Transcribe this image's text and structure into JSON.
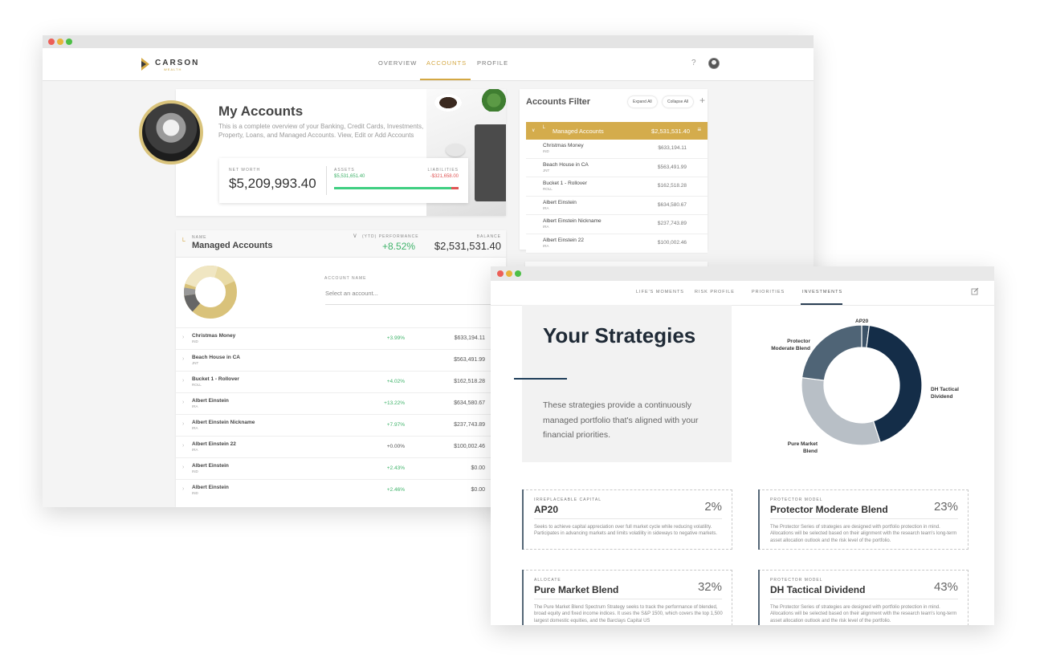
{
  "accounts_window": {
    "logo": "CARSON",
    "logo_sub": "WEALTH",
    "nav": [
      "OVERVIEW",
      "ACCOUNTS",
      "PROFILE"
    ],
    "help": "?",
    "my_accounts": {
      "title": "My Accounts",
      "description": "This is a complete overview of your Banking, Credit Cards, Investments, Property, Loans, and Managed Accounts. View, Edit or Add Accounts",
      "net_worth_label": "NET WORTH",
      "net_worth": "$5,209,993.40",
      "assets_label": "ASSETS",
      "assets": "$5,531,651.40",
      "liabilities_label": "LIABILITIES",
      "liabilities": "-$321,658.00",
      "asset_share": 0.945
    },
    "managed": {
      "name_label": "NAME",
      "title": "Managed Accounts",
      "performance_label": "(YTD) PERFORMANCE",
      "performance": "+8.52%",
      "balance_label": "BALANCE",
      "balance": "$2,531,531.40",
      "account_name_label": "ACCOUNT NAME",
      "account_placeholder": "Select an account...",
      "rows": [
        {
          "name": "Christmas Money",
          "type": "IND",
          "perf": "+3.99%",
          "balance": "$633,194.11"
        },
        {
          "name": "Beach House in CA",
          "type": "JNT",
          "perf": "",
          "balance": "$563,491.99"
        },
        {
          "name": "Bucket 1 - Rollover",
          "type": "ROLL",
          "perf": "+4.02%",
          "balance": "$162,518.28"
        },
        {
          "name": "Albert Einstein",
          "type": "IRA",
          "perf": "+13.22%",
          "balance": "$634,580.67"
        },
        {
          "name": "Albert Einstein Nickname",
          "type": "IRA",
          "perf": "+7.97%",
          "balance": "$237,743.89"
        },
        {
          "name": "Albert Einstein 22",
          "type": "IRA",
          "perf": "+0.00%",
          "balance": "$100,002.46"
        },
        {
          "name": "Albert Einstein",
          "type": "IND",
          "perf": "+2.43%",
          "balance": "$0.00"
        },
        {
          "name": "Albert Einstein",
          "type": "IND",
          "perf": "+2.46%",
          "balance": "$0.00"
        }
      ]
    },
    "filter": {
      "title": "Accounts Filter",
      "expand": "Expand All",
      "collapse": "Collapse All",
      "plus": "+",
      "group": "Managed Accounts",
      "group_value": "$2,531,531.40",
      "rows": [
        {
          "name": "Christmas Money",
          "type": "IND",
          "balance": "$633,194.11"
        },
        {
          "name": "Beach House in CA",
          "type": "JNT",
          "balance": "$563,491.99"
        },
        {
          "name": "Bucket 1 - Rollover",
          "type": "ROLL",
          "balance": "$162,518.28"
        },
        {
          "name": "Albert Einstein",
          "type": "IRA",
          "balance": "$634,580.67"
        },
        {
          "name": "Albert Einstein Nickname",
          "type": "IRA",
          "balance": "$237,743.89"
        },
        {
          "name": "Albert Einstein 22",
          "type": "IRA",
          "balance": "$100,002.46"
        }
      ]
    },
    "colors": {
      "gold": "#d4a843",
      "green": "#3fb36a",
      "red": "#e05555"
    }
  },
  "strategies_window": {
    "tabs": [
      "LIFE'S MOMENTS",
      "RISK PROFILE",
      "PRIORITIES",
      "INVESTMENTS"
    ],
    "title": "Your Strategies",
    "description": "These strategies provide a continuously managed portfolio that's aligned with your financial priorities.",
    "donut_labels": {
      "ap20": "AP20",
      "protector": "Protector Moderate Blend",
      "dh": "DH Tactical Dividend",
      "pure": "Pure Market Blend"
    },
    "cards": [
      {
        "category": "IRREPLACEABLE CAPITAL",
        "name": "AP20",
        "percent": "2%",
        "desc": "Seeks to achieve capital appreciation over full market cycle while reducing volatility. Participates in advancing markets and limits volatility in sideways to negative markets."
      },
      {
        "category": "PROTECTOR MODEL",
        "name": "Protector Moderate Blend",
        "percent": "23%",
        "desc": "The Protector Series of strategies are designed with portfolio protection in mind. Allocations will be selected based on their alignment with the research team's long-term asset allocation outlook and the risk level of the portfolio."
      },
      {
        "category": "ALLOCATE",
        "name": "Pure Market Blend",
        "percent": "32%",
        "desc": "The Pure Market Blend Spectrum Strategy seeks to track the performance of blended, broad equity and fixed income indices. It uses the S&P 1500, which covers the top 1,500 largest domestic equities, and the Barclays Capital US"
      },
      {
        "category": "PROTECTOR MODEL",
        "name": "DH Tactical Dividend",
        "percent": "43%",
        "desc": "The Protector Series of strategies are designed with portfolio protection in mind. Allocations will be selected based on their alignment with the research team's long-term asset allocation outlook and the risk level of the portfolio."
      }
    ],
    "allocation": [
      {
        "label": "AP20",
        "value": 2,
        "color": "#3d5368"
      },
      {
        "label": "DH Tactical Dividend",
        "value": 43,
        "color": "#142d48"
      },
      {
        "label": "Pure Market Blend",
        "value": 32,
        "color": "#b8bfc6"
      },
      {
        "label": "Protector Moderate Blend",
        "value": 23,
        "color": "#4f6476"
      }
    ]
  }
}
